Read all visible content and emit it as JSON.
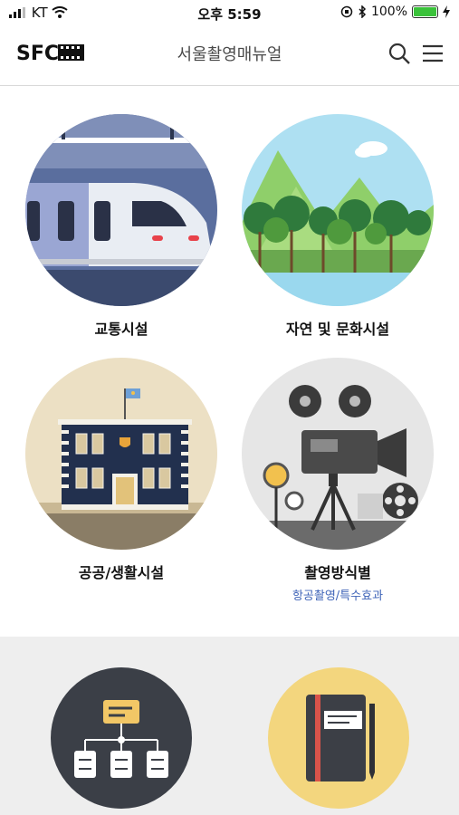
{
  "status": {
    "carrier": "KT",
    "time": "오후 5:59",
    "battery": "100%"
  },
  "header": {
    "title": "서울촬영매뉴얼",
    "logo": "SFC"
  },
  "categories": [
    {
      "label": "교통시설",
      "icon": "train-illustration"
    },
    {
      "label": "자연 및 문화시설",
      "icon": "nature-illustration"
    },
    {
      "label": "공공/생활시설",
      "icon": "building-illustration"
    },
    {
      "label": "촬영방식별",
      "sub": "항공촬영/특수효과",
      "icon": "camera-illustration"
    }
  ],
  "lower": [
    {
      "icon": "org-chart-illustration"
    },
    {
      "icon": "notebook-illustration"
    }
  ],
  "colors": {
    "accent": "#3f64b8",
    "battery": "#3ac23a"
  }
}
